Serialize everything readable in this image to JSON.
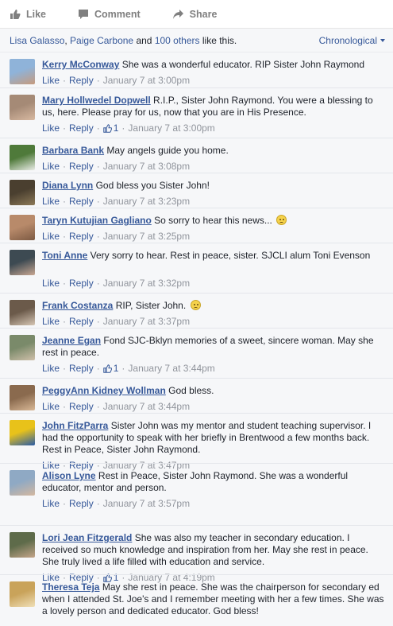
{
  "actions": {
    "like": "Like",
    "comment": "Comment",
    "share": "Share"
  },
  "likes": {
    "name1": "Lisa Galasso",
    "sep1": ", ",
    "name2": "Paige Carbone",
    "and": " and ",
    "others": "100 others",
    "suffix": " like this."
  },
  "sort": {
    "label": "Chronological"
  },
  "labels": {
    "like": "Like",
    "reply": "Reply",
    "dot": "·"
  },
  "colors": {
    "link": "#365899",
    "meta": "#90949c",
    "background": "#f6f7f9"
  },
  "comments": [
    {
      "name": "Kerry McConway",
      "text": "She was a wonderful educator. RIP Sister John Raymond",
      "time": "January 7 at 3:00pm",
      "likes": "",
      "emoji": false,
      "avatar": [
        "#8fb3d9",
        "#c79a7d"
      ]
    },
    {
      "name": "Mary Hollwedel Dopwell",
      "text": "R.I.P., Sister John Raymond. You were a blessing to us, here. Please pray for us, now that you are in His Presence.",
      "time": "January 7 at 3:00pm",
      "likes": "1",
      "emoji": false,
      "avatar": [
        "#a58a76",
        "#d8b9a1"
      ]
    },
    {
      "name": "Barbara Bank",
      "text": "May angels guide you home.",
      "time": "January 7 at 3:08pm",
      "likes": "",
      "emoji": false,
      "avatar": [
        "#4f7a3a",
        "#e9ece6"
      ]
    },
    {
      "name": "Diana Lynn",
      "text": "God bless you Sister John!",
      "time": "January 7 at 3:23pm",
      "likes": "",
      "emoji": false,
      "avatar": [
        "#4a3f2f",
        "#8d7a58"
      ]
    },
    {
      "name": "Taryn Kutujian Gagliano",
      "text": "So sorry to hear this news...",
      "time": "January 7 at 3:25pm",
      "likes": "",
      "emoji": true,
      "avatar": [
        "#b88a6a",
        "#7d5a43"
      ]
    },
    {
      "name": "Toni Anne",
      "text": "Very sorry to hear. Rest in peace, sister. SJCLI alum Toni Evenson",
      "time": "January 7 at 3:32pm",
      "likes": "",
      "emoji": false,
      "avatar": [
        "#3d4a52",
        "#c9a893"
      ]
    },
    {
      "name": "Frank Costanza",
      "text": "RIP, Sister John.",
      "time": "January 7 at 3:37pm",
      "likes": "",
      "emoji": true,
      "avatar": [
        "#6b5a4a",
        "#d6c6b4"
      ]
    },
    {
      "name": "Jeanne Egan",
      "text": "Fond SJC-Bklyn memories of a sweet, sincere woman. May she rest in peace.",
      "time": "January 7 at 3:44pm",
      "likes": "1",
      "emoji": false,
      "avatar": [
        "#7a8a6a",
        "#cfc0aa"
      ]
    },
    {
      "name": "PeggyAnn Kidney Wollman",
      "text": "God bless.",
      "time": "January 7 at 3:44pm",
      "likes": "",
      "emoji": false,
      "avatar": [
        "#8a6a4e",
        "#d9b896"
      ]
    },
    {
      "name": "John FitzParra",
      "text": "Sister John was my mentor and student teaching supervisor. I had the opportunity to speak with her briefly in Brentwood a few months back. Rest in Peace, Sister John Raymond.",
      "time": "January 7 at 3:47pm",
      "likes": "",
      "emoji": false,
      "avatar": [
        "#e8c21a",
        "#2a5ca8"
      ]
    },
    {
      "name": "Alison Lyne",
      "text": "Rest in Peace, Sister John Raymond. She was a wonderful educator, mentor and person.",
      "time": "January 7 at 3:57pm",
      "likes": "",
      "emoji": false,
      "avatar": [
        "#8fa9c4",
        "#d4b8a0"
      ]
    },
    {
      "name": "Lori Jean Fitzgerald",
      "text": "She was also my teacher in secondary education. I received so much knowledge and inspiration from her. May she rest in peace. She truly lived a life filled with education and service.",
      "time": "January 7 at 4:19pm",
      "likes": "1",
      "emoji": false,
      "avatar": [
        "#5e6b4a",
        "#c4a58a"
      ]
    },
    {
      "name": "Theresa Teja",
      "text": "May she rest in peace. She was the chairperson for secondary ed when I attended St. Joe's and I remember meeting with her a few times. She was a lovely person and dedicated educator. God bless!",
      "time": "",
      "likes": "",
      "emoji": false,
      "avatar": [
        "#c9a35a",
        "#f0e0b8"
      ]
    }
  ]
}
